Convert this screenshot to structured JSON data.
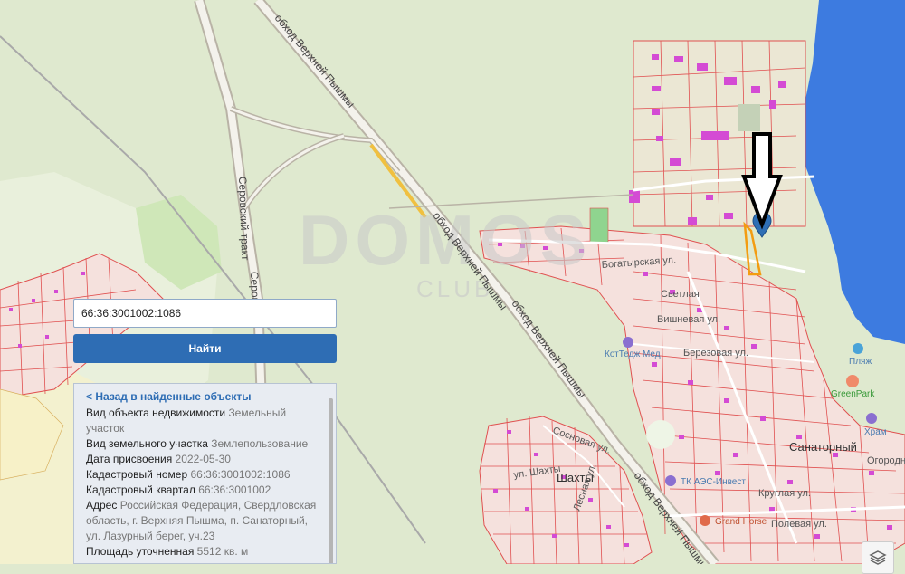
{
  "map": {
    "watermark": "DOMOS",
    "watermark_sub": "CLUB",
    "roads": {
      "bypass_north": "обход Верхней Пышмы",
      "bypass_mid": "обход Верхней Пышмы",
      "bypass_south": "обход Верхней Пышмы",
      "bypass_south2": "обход Верхней Пышмы",
      "serov_1": "Серовский тракт",
      "serov_2": "Серов"
    },
    "streets": {
      "bogatyr": "Богатырская ул.",
      "svetl": "Светлая",
      "vishn": "Вишневая ул.",
      "berez": "Березовая ул.",
      "sosnov": "Сосновая ул.",
      "shakhty_ul": "ул. Шахты",
      "lesnaya": "Лесная ул.",
      "polevaya": "Полевая ул.",
      "ogorodn": "Огородн.",
      "kruglaya": "Круглая ул."
    },
    "places": {
      "shakhty": "Шахты",
      "sanatorny": "Санаторный"
    },
    "pois": {
      "kotedzh": "КотТедж Мед",
      "beach": "Пляж",
      "greenpark": "GreenPark",
      "temple": "Храм",
      "tk": "ТК АЭС-Инвест",
      "grandhorse": "Grand Horse"
    },
    "colors": {
      "background": "#dfe9cf",
      "water": "#3d7be0",
      "parcel_border": "#e05050",
      "parcel_fill": "#f5e1dd",
      "building": "#d44bd4",
      "selected_parcel": "#f39c12",
      "marker": "#2f6fb5"
    }
  },
  "search": {
    "value": "66:36:3001002:1086",
    "placeholder": "",
    "button_label": "Найти"
  },
  "panel": {
    "back_link": "< Назад в найденные объекты",
    "rows": [
      {
        "key": "Вид объекта недвижимости",
        "value": "Земельный участок"
      },
      {
        "key": "Вид земельного участка",
        "value": "Землепользование"
      },
      {
        "key": "Дата присвоения",
        "value": "2022-05-30"
      },
      {
        "key": "Кадастровый номер",
        "value": "66:36:3001002:1086"
      },
      {
        "key": "Кадастровый квартал",
        "value": "66:36:3001002"
      },
      {
        "key": "Адрес",
        "value": "Российская Федерация, Свердловская область, г. Верхняя Пышма, п. Санаторный, ул. Лазурный берег, уч.23"
      },
      {
        "key": "Площадь уточненная",
        "value": "5512 кв. м"
      }
    ]
  }
}
